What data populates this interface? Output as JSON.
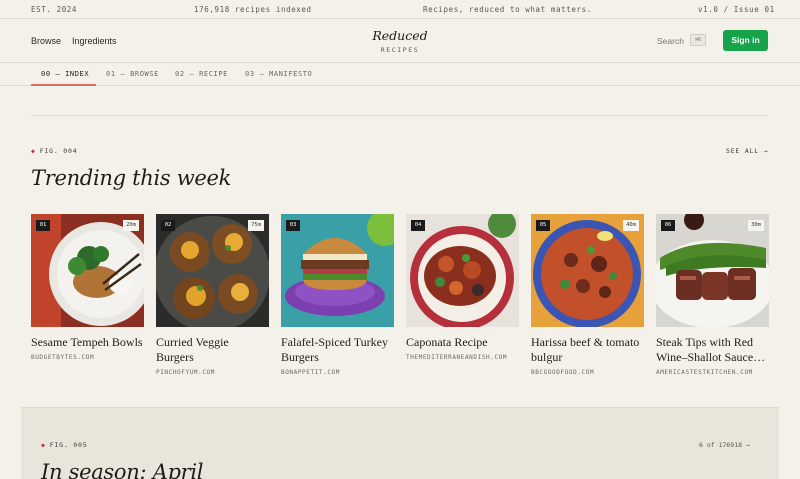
{
  "topstrip": {
    "est": "EST. 2024",
    "count": "176,918 recipes indexed",
    "tagline": "Recipes, reduced to what matters.",
    "issue": "v1.0 / Issue 01"
  },
  "header": {
    "nav": [
      "Browse",
      "Ingredients"
    ],
    "logo_title": "Reduced",
    "logo_sub": "RECIPES",
    "search_label": "Search",
    "search_kbd": "⌘K",
    "signin_label": "Sign in"
  },
  "tabs": [
    {
      "label": "00 — INDEX",
      "active": true
    },
    {
      "label": "01 — BROWSE",
      "active": false
    },
    {
      "label": "02 — RECIPE",
      "active": false
    },
    {
      "label": "03 — MANIFESTO",
      "active": false
    }
  ],
  "trending": {
    "fig": "FIG. 004",
    "see_all": "SEE ALL →",
    "title": "Trending this week",
    "cards": [
      {
        "rank": "01",
        "time": "20m",
        "title": "Sesame Tempeh Bowls",
        "source": "BUDGETBYTES.COM"
      },
      {
        "rank": "02",
        "time": "75m",
        "title": "Curried Veggie Burgers",
        "source": "PINCHOFYUM.COM"
      },
      {
        "rank": "03",
        "time": "",
        "title": "Falafel-Spiced Turkey Burgers",
        "source": "BONAPPETIT.COM"
      },
      {
        "rank": "04",
        "time": "",
        "title": "Caponata Recipe",
        "source": "THEMEDITERRANEANDISH.COM"
      },
      {
        "rank": "05",
        "time": "40m",
        "title": "Harissa beef & tomato bulgur",
        "source": "BBCGOODFOOD.COM"
      },
      {
        "rank": "06",
        "time": "30m",
        "title": "Steak Tips with Red Wine–Shallot Sauce and...",
        "source": "AMERICASTESTKITCHEN.COM"
      }
    ]
  },
  "season": {
    "fig": "FIG. 005",
    "count": "6 of 176918 →",
    "title": "In season: April"
  },
  "colors": {
    "accent": "#16a34a",
    "tab_underline": "#e06a5a",
    "dot": "#b23b3b"
  }
}
